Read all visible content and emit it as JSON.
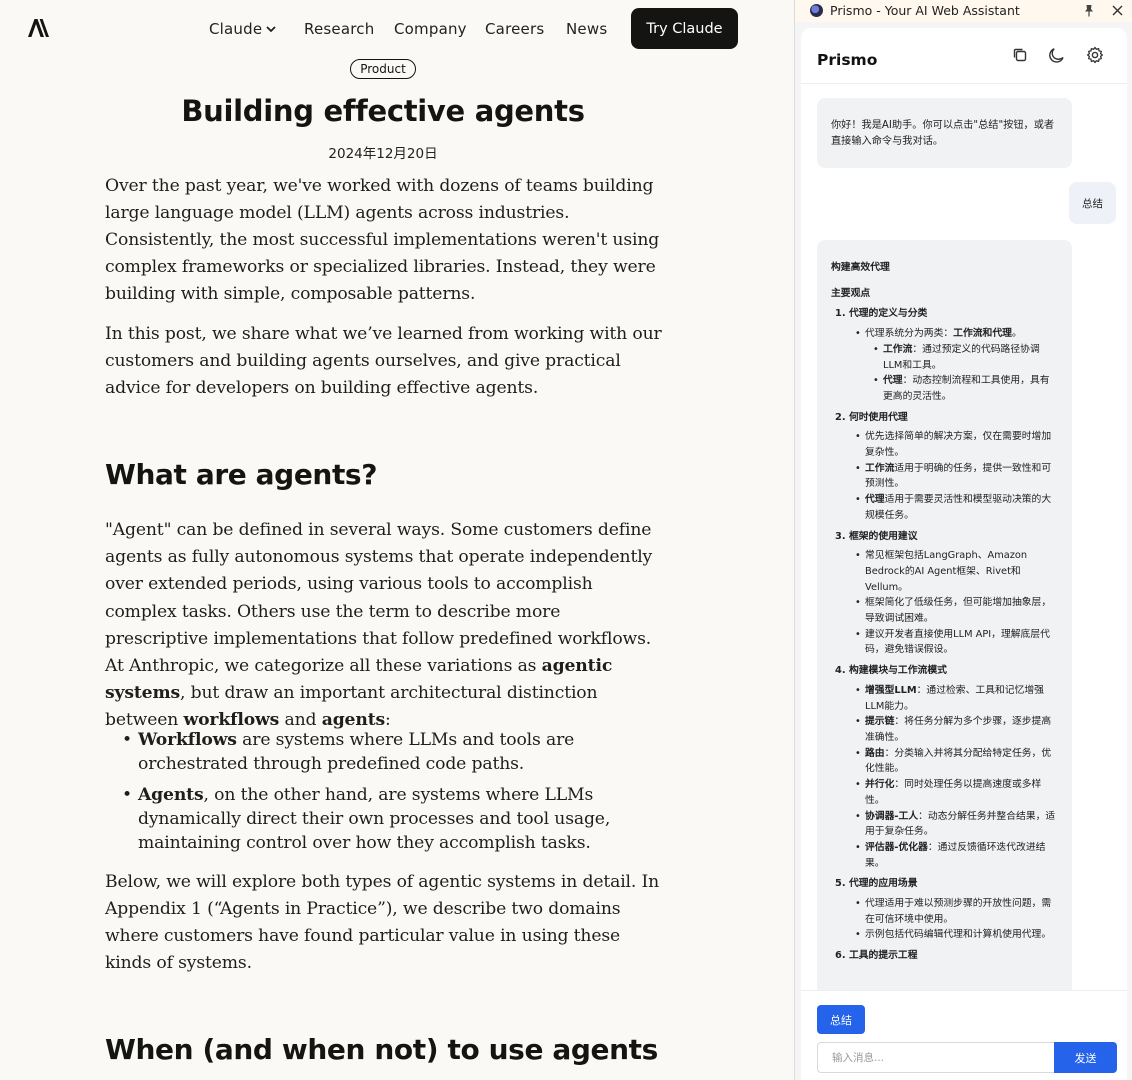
{
  "site": {
    "nav": {
      "claude": "Claude",
      "research": "Research",
      "company": "Company",
      "careers": "Careers",
      "news": "News",
      "try_button": "Try Claude"
    },
    "article": {
      "tag": "Product",
      "title": "Building effective agents",
      "date": "2024年12月20日",
      "p1": "Over the past year, we've worked with dozens of teams building large language model (LLM) agents across industries. Consistently, the most successful implementations weren't using complex frameworks or specialized libraries. Instead, they were building with simple, composable patterns.",
      "p2": "In this post, we share what we’ve learned from working with our customers and building agents ourselves, and give practical advice for developers on building effective agents.",
      "h_agents": "What are agents?",
      "p3_a": "\"Agent\" can be defined in several ways. Some customers define agents as fully autonomous systems that operate independently over extended periods, using various tools to accomplish complex tasks. Others use the term to describe more prescriptive implementations that follow predefined workflows. At Anthropic, we categorize all these variations as ",
      "p3_b1": "agentic systems",
      "p3_c": ", but draw an important architectural distinction between ",
      "p3_b2": "workflows",
      "p3_d": " and ",
      "p3_b3": "agents",
      "p3_e": ":",
      "b1_bold": "Workflows",
      "b1_text": " are systems where LLMs and tools are orchestrated through predefined code paths.",
      "b2_bold": "Agents",
      "b2_text": ", on the other hand, are systems where LLMs dynamically direct their own processes and tool usage, maintaining control over how they accomplish tasks.",
      "p4": "Below, we will explore both types of agentic systems in detail. In Appendix 1 (“Agents in Practice”), we describe two domains where customers have found particular value in using these kinds of systems.",
      "h_when": "When (and when not) to use agents"
    }
  },
  "panel": {
    "window_title": "Prismo - Your AI Web Assistant",
    "brand": "Prismo",
    "greeting": "你好！我是AI助手。你可以点击\"总结\"按钮，或者直接输入命令与我对话。",
    "user_msg": "总结",
    "summary": {
      "title": "构建高效代理",
      "subtitle": "主要观点",
      "s1": "1. 代理的定义与分类",
      "s1_i1_pre": "代理系统分为两类：",
      "s1_i1_bold": "工作流和代理",
      "s1_i1_post": "。",
      "s1_i1a_bold": "工作流",
      "s1_i1a_text": "：通过预定义的代码路径协调LLM和工具。",
      "s1_i1b_bold": "代理",
      "s1_i1b_text": "：动态控制流程和工具使用，具有更高的灵活性。",
      "s2": "2. 何时使用代理",
      "s2_i1": "优先选择简单的解决方案，仅在需要时增加复杂性。",
      "s2_i2_bold": "工作流",
      "s2_i2_text": "适用于明确的任务，提供一致性和可预测性。",
      "s2_i3_bold": "代理",
      "s2_i3_text": "适用于需要灵活性和模型驱动决策的大规模任务。",
      "s3": "3. 框架的使用建议",
      "s3_i1": "常见框架包括LangGraph、Amazon Bedrock的AI Agent框架、Rivet和Vellum。",
      "s3_i2": "框架简化了低级任务，但可能增加抽象层，导致调试困难。",
      "s3_i3": "建议开发者直接使用LLM API，理解底层代码，避免错误假设。",
      "s4": "4. 构建模块与工作流模式",
      "s4_i1_bold": "增强型LLM",
      "s4_i1_text": "：通过检索、工具和记忆增强LLM能力。",
      "s4_i2_bold": "提示链",
      "s4_i2_text": "：将任务分解为多个步骤，逐步提高准确性。",
      "s4_i3_bold": "路由",
      "s4_i3_text": "：分类输入并将其分配给特定任务，优化性能。",
      "s4_i4_bold": "并行化",
      "s4_i4_text": "：同时处理任务以提高速度或多样性。",
      "s4_i5_bold": "协调器-工人",
      "s4_i5_text": "：动态分解任务并整合结果，适用于复杂任务。",
      "s4_i6_bold": "评估器-优化器",
      "s4_i6_text": "：通过反馈循环迭代改进结果。",
      "s5": "5. 代理的应用场景",
      "s5_i1": "代理适用于难以预测步骤的开放性问题，需在可信环境中使用。",
      "s5_i2": "示例包括代码编辑代理和计算机使用代理。",
      "s6": "6. 工具的提示工程"
    },
    "summarize_button": "总结",
    "input_placeholder": "输入消息...",
    "send_button": "发送"
  }
}
